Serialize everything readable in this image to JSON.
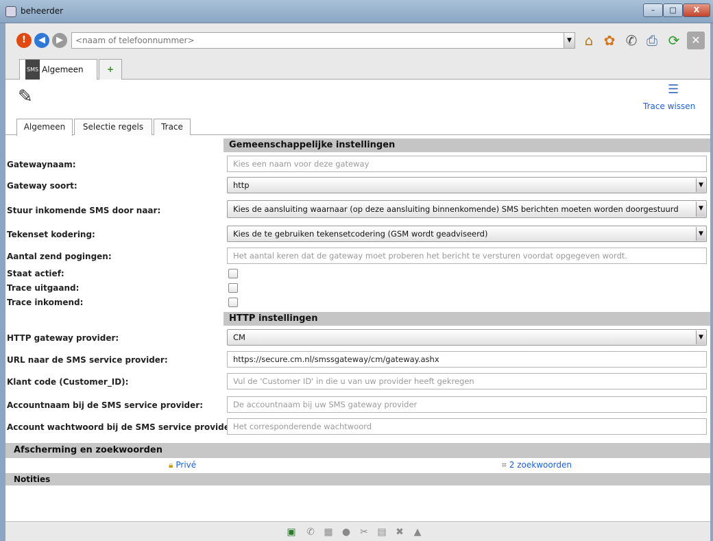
{
  "window": {
    "title": "beheerder",
    "controls": {
      "minimize": "–",
      "maximize": "□",
      "close": "X"
    }
  },
  "navbar": {
    "search_placeholder": "<naam of telefoonnummer>",
    "icons": [
      "stop-icon",
      "back-icon",
      "forward-icon",
      "home-icon",
      "puzzle-icon",
      "phone-icon",
      "print-icon",
      "refresh-icon",
      "close-icon"
    ]
  },
  "top_tabs": {
    "main_label": "Algemeen",
    "sms_badge": "SMS",
    "add_label": "+"
  },
  "pane": {
    "trace_wipe_label": "Trace wissen",
    "subtabs": [
      "Algemeen",
      "Selectie regels",
      "Trace"
    ]
  },
  "sections": {
    "general": "Gemeenschappelijke instellingen",
    "http": "HTTP instellingen",
    "shielding": "Afscherming en zoekwoorden",
    "notes": "Notities"
  },
  "form": {
    "gateway_name": {
      "label": "Gatewaynaam:",
      "placeholder": "Kies een naam voor deze gateway"
    },
    "gateway_type": {
      "label": "Gateway soort:",
      "value": "http"
    },
    "forward_sms": {
      "label": "Stuur inkomende SMS door naar:",
      "value": "Kies de aansluiting waarnaar (op deze aansluiting binnenkomende) SMS berichten moeten worden doorgestuurd"
    },
    "charset": {
      "label": "Tekenset kodering:",
      "value": "Kies de te gebruiken tekensetcodering (GSM wordt geadviseerd)"
    },
    "attempts": {
      "label": "Aantal zend pogingen:",
      "placeholder": "Het aantal keren dat de gateway moet proberen het bericht te versturen voordat opgegeven wordt."
    },
    "active": {
      "label": "Staat actief:"
    },
    "trace_out": {
      "label": "Trace uitgaand:"
    },
    "trace_in": {
      "label": "Trace inkomend:"
    },
    "http_provider": {
      "label": "HTTP gateway provider:",
      "value": "CM"
    },
    "url": {
      "label": "URL naar de SMS service provider:",
      "value": "https://secure.cm.nl/smssgateway/cm/gateway.ashx"
    },
    "customer_code": {
      "label": "Klant code (Customer_ID):",
      "placeholder": "Vul de 'Customer ID' in die u van uw provider heeft gekregen"
    },
    "account_name": {
      "label": "Accountnaam bij de SMS service provider:",
      "placeholder": "De accountnaam bij uw SMS gateway provider"
    },
    "account_password": {
      "label": "Account wachtwoord bij de SMS service provider:",
      "placeholder": "Het corresponderende wachtwoord"
    }
  },
  "shielding": {
    "private_label": "Privé",
    "keywords_label": "2 zoekwoorden"
  },
  "bottom_icons": [
    "sms-icon",
    "phone-handset-icon",
    "building-icon",
    "circle-icon",
    "tools-icon",
    "document-icon",
    "cross-icon",
    "warning-icon"
  ]
}
